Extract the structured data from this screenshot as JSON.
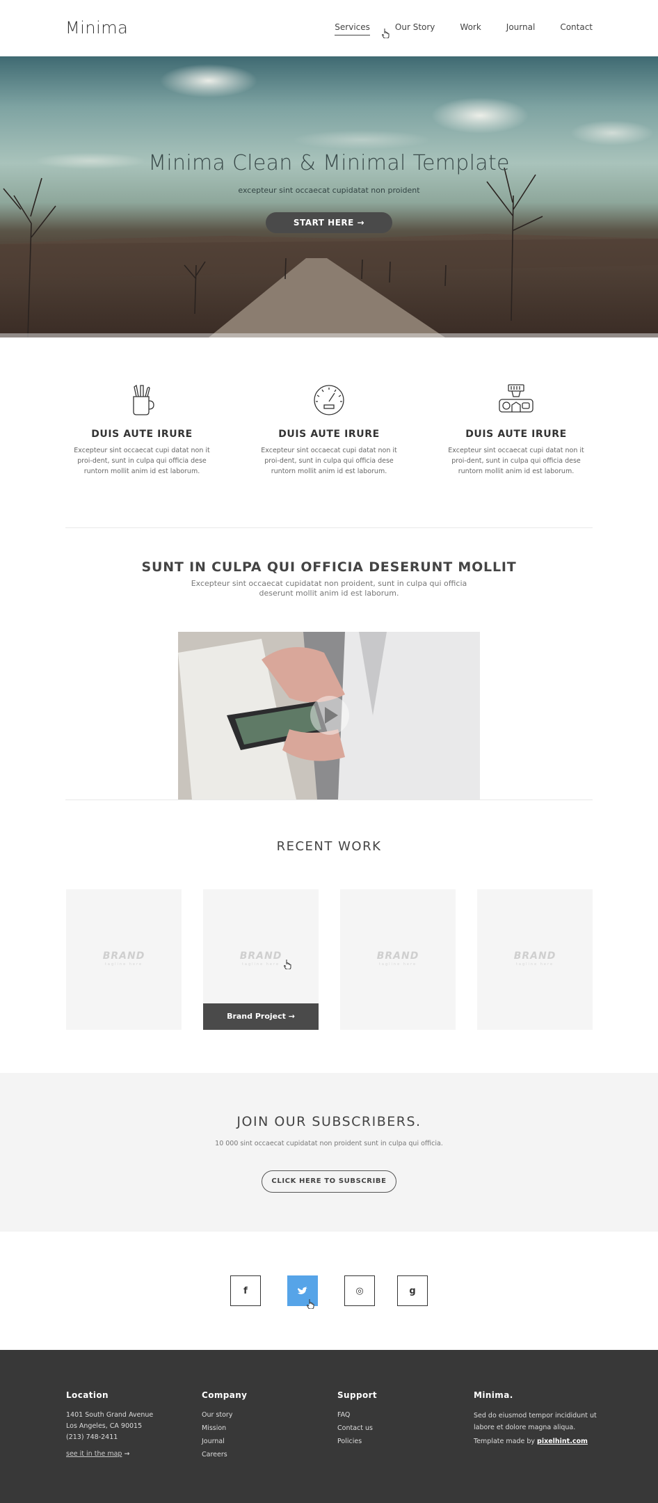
{
  "header": {
    "logo": "Minima",
    "nav": [
      "Services",
      "Our Story",
      "Work",
      "Journal",
      "Contact"
    ]
  },
  "hero": {
    "title": "Minima Clean & Minimal Template",
    "subtitle": "excepteur sint occaecat cupidatat non proident",
    "button": "START HERE →"
  },
  "features": [
    {
      "icon": "pencil-cup-icon",
      "title": "DUIS AUTE IRURE",
      "text": "Excepteur sint occaecat cupi datat non it proi-dent, sunt in culpa qui officia dese runtorn mollit anim id est laborum."
    },
    {
      "icon": "speedometer-icon",
      "title": "DUIS AUTE IRURE",
      "text": "Excepteur sint occaecat cupi datat non it proi-dent, sunt in culpa qui officia dese runtorn mollit anim id est laborum."
    },
    {
      "icon": "coffee-machine-icon",
      "title": "DUIS AUTE IRURE",
      "text": "Excepteur sint occaecat cupi datat non it proi-dent, sunt in culpa qui officia dese runtorn mollit anim id est laborum."
    }
  ],
  "intro": {
    "title": "SUNT IN CULPA QUI OFFICIA DESERUNT MOLLIT",
    "subtitle": "Excepteur sint occaecat cupidatat non proident, sunt in culpa qui officia deserunt mollit anim id est laborum."
  },
  "recent_work": {
    "title": "RECENT WORK",
    "cards": [
      {
        "brand": "BRAND",
        "tagline": "tagline here"
      },
      {
        "brand": "BRAND",
        "tagline": "tagline here",
        "overlay": "Brand Project →"
      },
      {
        "brand": "BRAND",
        "tagline": "tagline here"
      },
      {
        "brand": "BRAND",
        "tagline": "tagline here"
      }
    ]
  },
  "subscribe": {
    "title": "JOIN OUR SUBSCRIBERS.",
    "text": "10 000 sint occaecat cupidatat non proident sunt in culpa qui officia.",
    "button": "CLICK HERE TO SUBSCRIBE"
  },
  "social": [
    {
      "icon": "facebook-icon",
      "glyph": "f"
    },
    {
      "icon": "twitter-icon",
      "glyph": "♥",
      "active": true
    },
    {
      "icon": "dribbble-icon",
      "glyph": "◎"
    },
    {
      "icon": "google-plus-icon",
      "glyph": "g"
    }
  ],
  "colors": {
    "accent": "#56a4e8",
    "dark": "#383838",
    "button": "#4a4a4a"
  },
  "footer": {
    "location": {
      "title": "Location",
      "lines": [
        "1401 South Grand Avenue",
        "Los Angeles, CA 90015",
        "(213) 748-2411"
      ],
      "map_link": "see it in the map",
      "map_arrow": "→"
    },
    "company": {
      "title": "Company",
      "items": [
        "Our story",
        "Mission",
        "Journal",
        "Careers"
      ]
    },
    "support": {
      "title": "Support",
      "items": [
        "FAQ",
        "Contact us",
        "Policies"
      ]
    },
    "about": {
      "title": "Minima.",
      "text": "Sed do eiusmod tempor incididunt ut labore et dolore magna aliqua.",
      "made_prefix": "Template made by ",
      "made_link": "pixelhint.com"
    }
  }
}
